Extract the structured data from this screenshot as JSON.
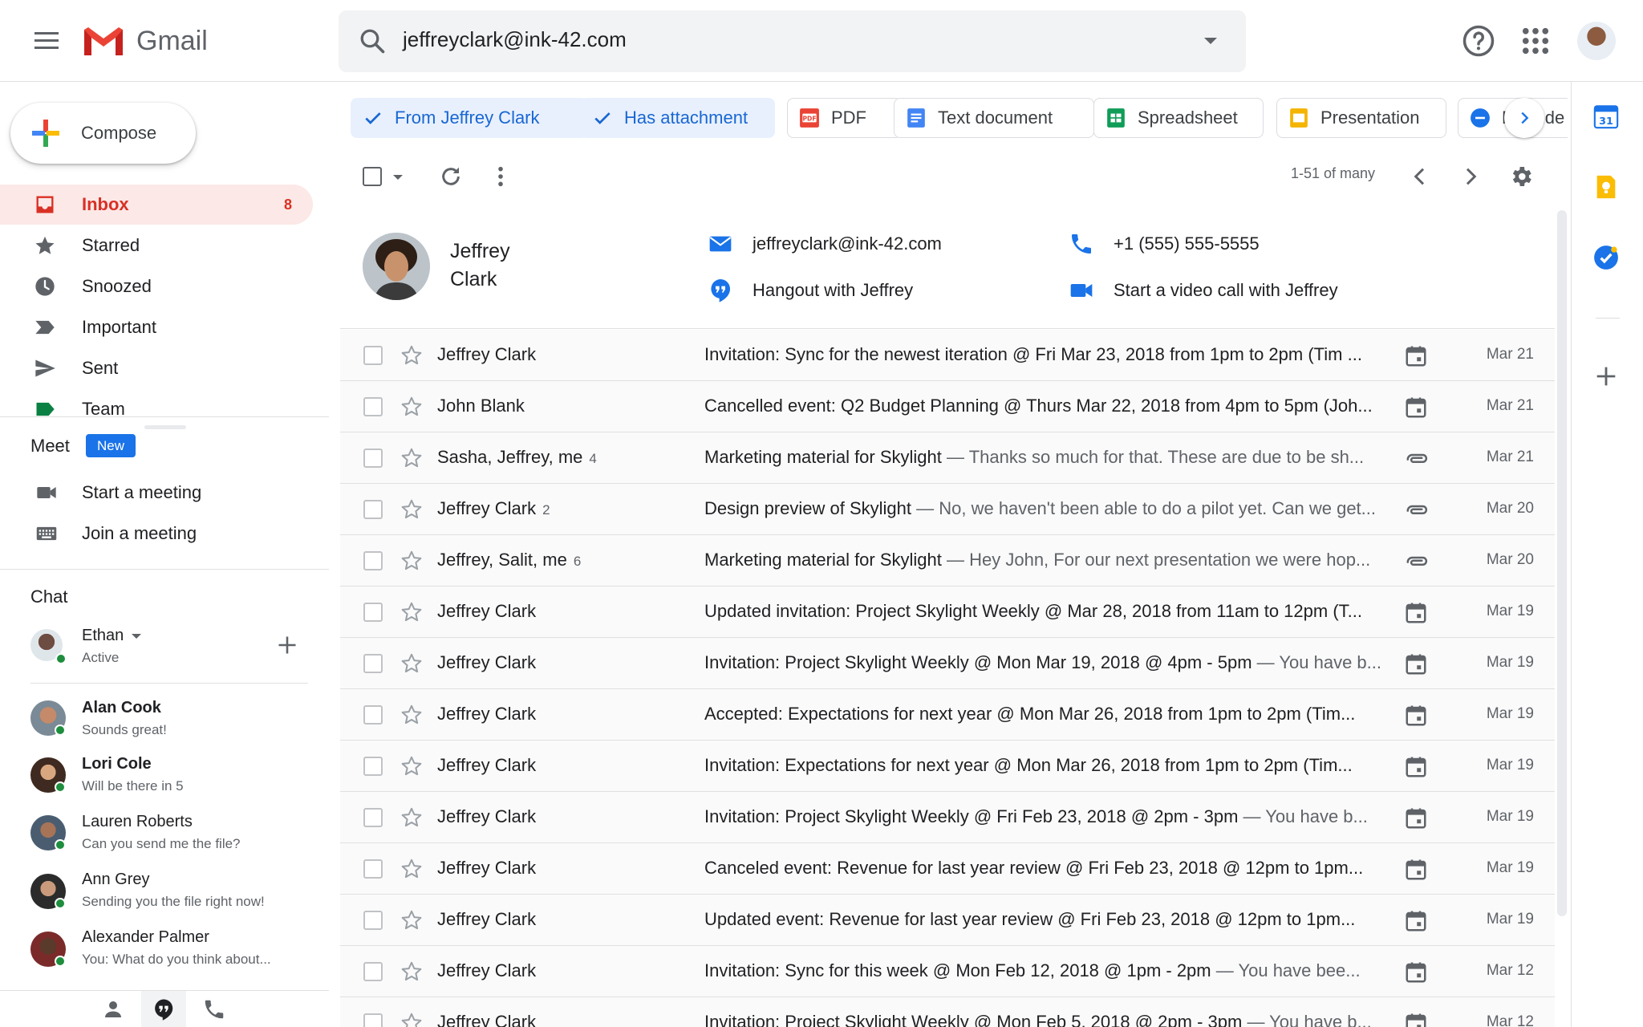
{
  "header": {
    "app_name": "Gmail",
    "search_value": "jeffreyclark@ink-42.com"
  },
  "sidebar": {
    "compose_label": "Compose",
    "items": [
      {
        "label": "Inbox",
        "count": "8",
        "icon": "inbox-icon"
      },
      {
        "label": "Starred",
        "icon": "star-icon"
      },
      {
        "label": "Snoozed",
        "icon": "clock-icon"
      },
      {
        "label": "Important",
        "icon": "important-icon"
      },
      {
        "label": "Sent",
        "icon": "send-icon"
      },
      {
        "label": "Team",
        "icon": "label-icon"
      }
    ],
    "meet": {
      "title": "Meet",
      "badge": "New",
      "items": [
        {
          "label": "Start a meeting",
          "icon": "video-icon"
        },
        {
          "label": "Join a meeting",
          "icon": "keyboard-icon"
        }
      ]
    },
    "chat": {
      "title": "Chat",
      "self": {
        "name": "Ethan",
        "status": "Active"
      },
      "contacts": [
        {
          "name": "Alan Cook",
          "message": "Sounds great!",
          "unread": true
        },
        {
          "name": "Lori Cole",
          "message": "Will be there in 5",
          "unread": true
        },
        {
          "name": "Lauren Roberts",
          "message": "Can you send me the file?",
          "unread": false
        },
        {
          "name": "Ann Grey",
          "message": "Sending you the file right now!",
          "unread": false
        },
        {
          "name": "Alexander Palmer",
          "message": "You: What do you think about...",
          "unread": false
        }
      ]
    }
  },
  "filters": {
    "chips": [
      {
        "label": "From Jeffrey Clark",
        "selected": true,
        "icon": "check-icon"
      },
      {
        "label": "Has attachment",
        "selected": true,
        "icon": "check-icon"
      },
      {
        "label": "PDF",
        "selected": false,
        "icon": "pdf-icon",
        "icon_text": "PDF"
      },
      {
        "label": "Text document",
        "selected": false,
        "icon": "docs-icon"
      },
      {
        "label": "Spreadsheet",
        "selected": false,
        "icon": "sheets-icon"
      },
      {
        "label": "Presentation",
        "selected": false,
        "icon": "slides-icon"
      },
      {
        "label": "Exclude",
        "selected": false,
        "icon": "minus-circle-icon"
      }
    ]
  },
  "toolbar": {
    "pager": "1-51 of many"
  },
  "contact": {
    "name": "Jeffrey Clark",
    "email": "jeffreyclark@ink-42.com",
    "phone": "+1 (555) 555-5555",
    "hangout": "Hangout with Jeffrey",
    "video": "Start a video call with Jeffrey"
  },
  "emails": [
    {
      "sender": "Jeffrey Clark",
      "count": "",
      "subject": "Invitation: Sync for the newest iteration @ Fri Mar 23, 2018 from 1pm to 2pm (Tim ...",
      "snippet": "",
      "icon": "calendar-icon",
      "date": "Mar 21"
    },
    {
      "sender": "John Blank",
      "count": "",
      "subject": "Cancelled event: Q2 Budget Planning @ Thurs Mar 22, 2018 from 4pm to 5pm (Joh...",
      "snippet": "",
      "icon": "calendar-icon",
      "date": "Mar 21"
    },
    {
      "sender": "Sasha, Jeffrey, me",
      "count": "4",
      "subject": "Marketing material for Skylight",
      "snippet": " — Thanks so much for that. These are due to be sh...",
      "icon": "attachment-icon",
      "date": "Mar 21"
    },
    {
      "sender": "Jeffrey Clark",
      "count": "2",
      "subject": "Design preview of Skylight",
      "snippet": " — No, we haven't been able to do a pilot yet. Can we get...",
      "icon": "attachment-icon",
      "date": "Mar 20"
    },
    {
      "sender": "Jeffrey, Salit, me",
      "count": "6",
      "subject": "Marketing material for Skylight",
      "snippet": " — Hey John, For our next presentation we were hop...",
      "icon": "attachment-icon",
      "date": "Mar 20"
    },
    {
      "sender": "Jeffrey Clark",
      "count": "",
      "subject": "Updated invitation: Project Skylight Weekly @ Mar 28, 2018 from 11am to 12pm (T...",
      "snippet": "",
      "icon": "calendar-icon",
      "date": "Mar 19"
    },
    {
      "sender": "Jeffrey Clark",
      "count": "",
      "subject": "Invitation: Project Skylight Weekly @ Mon Mar 19, 2018 @ 4pm - 5pm",
      "snippet": " — You have b...",
      "icon": "calendar-icon",
      "date": "Mar 19"
    },
    {
      "sender": "Jeffrey Clark",
      "count": "",
      "subject": "Accepted: Expectations for next year @ Mon Mar 26, 2018 from 1pm to 2pm (Tim...",
      "snippet": "",
      "icon": "calendar-icon",
      "date": "Mar 19"
    },
    {
      "sender": "Jeffrey Clark",
      "count": "",
      "subject": "Invitation: Expectations for next year @ Mon Mar 26, 2018 from 1pm to 2pm (Tim...",
      "snippet": "",
      "icon": "calendar-icon",
      "date": "Mar 19"
    },
    {
      "sender": "Jeffrey Clark",
      "count": "",
      "subject": "Invitation: Project Skylight Weekly @ Fri Feb 23, 2018 @ 2pm - 3pm",
      "snippet": " — You have b...",
      "icon": "calendar-icon",
      "date": "Mar 19"
    },
    {
      "sender": "Jeffrey Clark",
      "count": "",
      "subject": "Canceled event: Revenue for last year review @ Fri Feb 23, 2018 @ 12pm to 1pm...",
      "snippet": "",
      "icon": "calendar-icon",
      "date": "Mar 19"
    },
    {
      "sender": "Jeffrey Clark",
      "count": "",
      "subject": "Updated event: Revenue for last year review @ Fri Feb 23, 2018 @ 12pm to 1pm...",
      "snippet": "",
      "icon": "calendar-icon",
      "date": "Mar 19"
    },
    {
      "sender": "Jeffrey Clark",
      "count": "",
      "subject": "Invitation: Sync for this week @ Mon Feb 12, 2018 @ 1pm - 2pm",
      "snippet": " — You have bee...",
      "icon": "calendar-icon",
      "date": "Mar 12"
    },
    {
      "sender": "Jeffrey Clark",
      "count": "",
      "subject": "Invitation: Project Skylight Weekly @ Mon Feb 5, 2018 @ 2pm - 3pm",
      "snippet": " — You have b...",
      "icon": "calendar-icon",
      "date": "Mar 12"
    }
  ],
  "side_panel": {
    "calendar_day": "31"
  },
  "colors": {
    "accent": "#1a73e8",
    "inbox_active_bg": "#fce8e6",
    "inbox_red": "#d93025",
    "chip_selected_bg": "#e8f0fe",
    "online_green": "#1e8e3e"
  }
}
